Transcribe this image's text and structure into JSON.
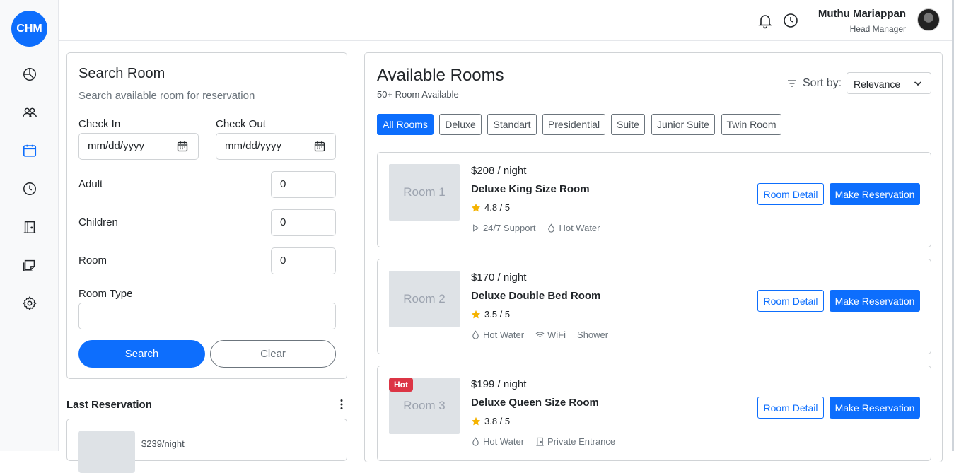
{
  "sidebar": {
    "logo": "CHM",
    "items": [
      {
        "icon": "dashboard-pie-icon",
        "active": false
      },
      {
        "icon": "users-icon",
        "active": false
      },
      {
        "icon": "calendar-icon",
        "active": true
      },
      {
        "icon": "clock-icon",
        "active": false
      },
      {
        "icon": "door-icon",
        "active": false
      },
      {
        "icon": "notes-icon",
        "active": false
      },
      {
        "icon": "gear-icon",
        "active": false
      }
    ]
  },
  "header": {
    "user_name": "Muthu Mariappan",
    "user_role": "Head Manager"
  },
  "search": {
    "title": "Search Room",
    "subtitle": "Search available room for reservation",
    "check_in_label": "Check In",
    "check_in_value": "mm/dd/yyyy",
    "check_out_label": "Check Out",
    "check_out_value": "mm/dd/yyyy",
    "adult_label": "Adult",
    "adult_value": "0",
    "children_label": "Children",
    "children_value": "0",
    "room_label": "Room",
    "room_value": "0",
    "room_type_label": "Room Type",
    "room_type_value": "",
    "search_button": "Search",
    "clear_button": "Clear"
  },
  "last_reservation": {
    "title": "Last Reservation",
    "price": "$239/night"
  },
  "rooms": {
    "title": "Available Rooms",
    "subtitle": "50+ Room Available",
    "sort_label": "Sort by:",
    "sort_value": "Relevance",
    "filters": [
      "All Rooms",
      "Deluxe",
      "Standart",
      "Presidential",
      "Suite",
      "Junior Suite",
      "Twin Room"
    ],
    "active_filter": "All Rooms",
    "detail_button": "Room Detail",
    "reserve_button": "Make Reservation",
    "list": [
      {
        "thumb": "Room 1",
        "hot": "",
        "price": "$208 / night",
        "name": "Deluxe King Size Room",
        "rating": "4.8 / 5",
        "amenities": [
          {
            "icon": "play-icon",
            "label": "24/7 Support"
          },
          {
            "icon": "droplet-icon",
            "label": "Hot Water"
          }
        ]
      },
      {
        "thumb": "Room 2",
        "hot": "",
        "price": "$170 / night",
        "name": "Deluxe Double Bed Room",
        "rating": "3.5 / 5",
        "amenities": [
          {
            "icon": "droplet-icon",
            "label": "Hot Water"
          },
          {
            "icon": "wifi-icon",
            "label": "WiFi"
          },
          {
            "icon": "",
            "label": "Shower"
          }
        ]
      },
      {
        "thumb": "Room 3",
        "hot": "Hot",
        "price": "$199 / night",
        "name": "Deluxe Queen Size Room",
        "rating": "3.8 / 5",
        "amenities": [
          {
            "icon": "droplet-icon",
            "label": "Hot Water"
          },
          {
            "icon": "door-icon",
            "label": "Private Entrance"
          }
        ]
      }
    ]
  },
  "colors": {
    "primary": "#0d6efd",
    "hot": "#dc3545",
    "star": "#f5b301"
  }
}
